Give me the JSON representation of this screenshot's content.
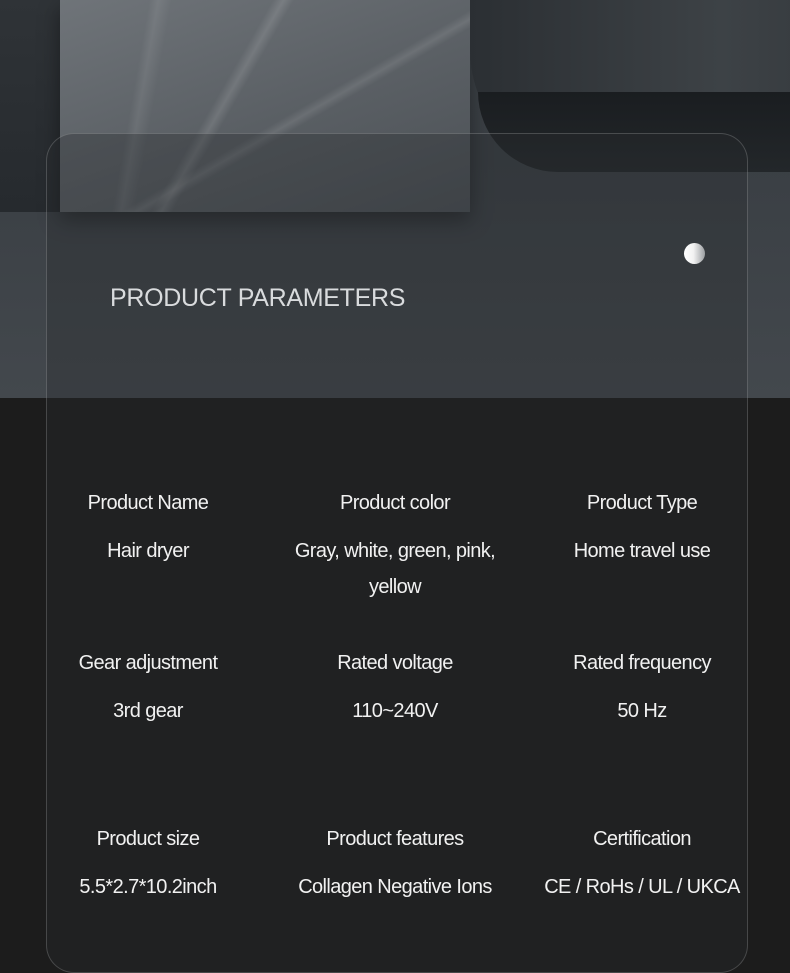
{
  "header": {
    "title": "PRODUCT PARAMETERS"
  },
  "params": [
    {
      "label": "Product Name",
      "value": "Hair dryer"
    },
    {
      "label": "Product color",
      "value": "Gray, white, green, pink, yellow"
    },
    {
      "label": "Product Type",
      "value": "Home travel use"
    },
    {
      "label": "Gear adjustment",
      "value": "3rd gear"
    },
    {
      "label": "Rated voltage",
      "value": "110~240V"
    },
    {
      "label": "Rated frequency",
      "value": "50 Hz"
    },
    {
      "label": "Product size",
      "value": "5.5*2.7*10.2inch"
    },
    {
      "label": "Product features",
      "value": "Collagen Negative Ions"
    },
    {
      "label": "Certification",
      "value": "CE / RoHs / UL / UKCA"
    }
  ],
  "colors": {
    "background": "#1c1c1c",
    "text": "#f1f1f1",
    "title": "#d9dbdd"
  }
}
